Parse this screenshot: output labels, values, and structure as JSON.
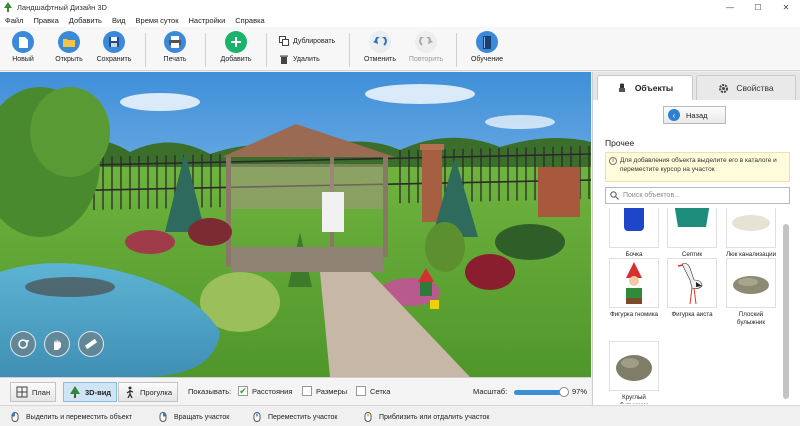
{
  "window": {
    "title": "Ландшафтный Дизайн 3D",
    "controls": [
      "—",
      "☐",
      "✕"
    ]
  },
  "menu": [
    "Файл",
    "Правка",
    "Добавить",
    "Вид",
    "Время суток",
    "Настройки",
    "Справка"
  ],
  "toolbar": {
    "new": "Новый",
    "open": "Открыть",
    "save": "Сохранить",
    "print": "Печать",
    "add": "Добавить",
    "duplicate": "Дублировать",
    "delete": "Удалить",
    "undo": "Отменить",
    "redo": "Повторить",
    "learning": "Обучение"
  },
  "panel": {
    "tab_objects": "Объекты",
    "tab_properties": "Свойства",
    "back": "Назад",
    "section": "Прочее",
    "hint": "Для добавления объекта выделите его в каталоге и переместите курсор на участок",
    "search_placeholder": "Поиск объектов...",
    "items": [
      {
        "label": "Бочка пластиковая",
        "icon": "barrel-icon"
      },
      {
        "label": "Септик",
        "icon": "septic-icon"
      },
      {
        "label": "Люк канализации",
        "icon": "manhole-icon"
      },
      {
        "label": "Фигурка гномика",
        "icon": "gnome-icon"
      },
      {
        "label": "Фигурка аиста",
        "icon": "stork-icon"
      },
      {
        "label": "Плоский булыжник",
        "icon": "flat-stone-icon"
      },
      {
        "label": "Круглый булыжник",
        "icon": "round-stone-icon"
      }
    ]
  },
  "view": {
    "plan": "План",
    "view3d": "3D-вид",
    "walk": "Прогулка",
    "show_label": "Показывать:",
    "distances": "Расстояния",
    "sizes": "Размеры",
    "grid": "Сетка",
    "distances_checked": true,
    "sizes_checked": false,
    "grid_checked": false,
    "zoom_label": "Масштаб:",
    "zoom_value": "97%",
    "zoom_fraction": 0.97
  },
  "status": {
    "select_move": "Выделить и переместить объект",
    "rotate": "Вращать участок",
    "pan": "Переместить участок",
    "zoom": "Приблизить или отдалить участок"
  },
  "colors": {
    "accent": "#2f7fd3",
    "add_green": "#19b36b",
    "grass": "#5fa83a",
    "water": "#4fa6c9"
  }
}
